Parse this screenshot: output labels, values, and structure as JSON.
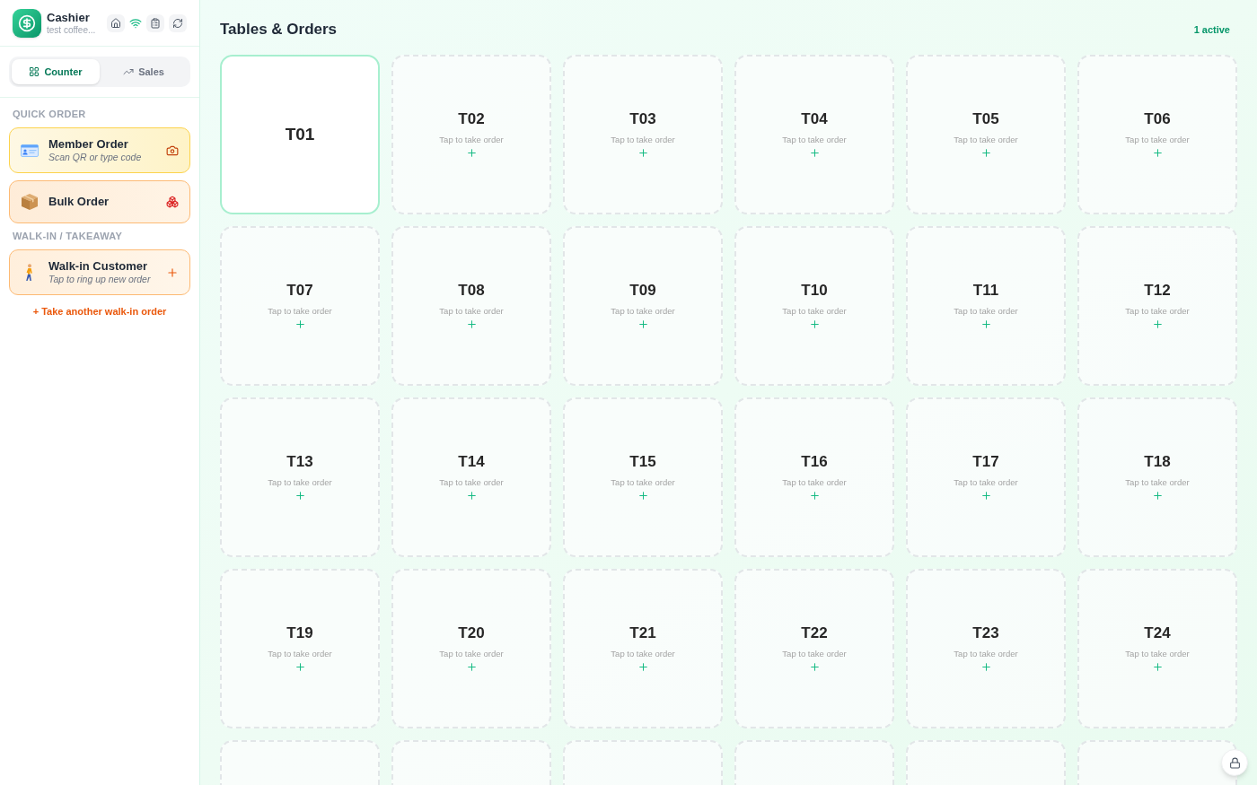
{
  "sidebar": {
    "header": {
      "title": "Cashier",
      "subtitle": "test coffee...",
      "online": true
    },
    "tabs": [
      {
        "label": "Counter",
        "selected": true
      },
      {
        "label": "Sales",
        "selected": false
      }
    ],
    "sections": [
      {
        "heading": "QUICK ORDER",
        "items": [
          {
            "kind": "member",
            "title": "Member Order",
            "subtitle": "Scan QR or type code"
          },
          {
            "kind": "bulk",
            "title": "Bulk Order"
          }
        ]
      },
      {
        "heading": "WALK-IN / TAKEAWAY",
        "items": [
          {
            "kind": "walk_in",
            "title": "Walk-in Customer",
            "subtitle": "Tap to ring up new order"
          }
        ],
        "link": "+ Take another walk-in order"
      }
    ]
  },
  "main": {
    "title": "Tables & Orders",
    "active_count": "1 active",
    "tables": [
      {
        "label": "T01",
        "active": true
      },
      {
        "label": "T02",
        "active": false,
        "hint": "Tap to take order"
      },
      {
        "label": "T03",
        "active": false,
        "hint": "Tap to take order"
      },
      {
        "label": "T04",
        "active": false,
        "hint": "Tap to take order"
      },
      {
        "label": "T05",
        "active": false,
        "hint": "Tap to take order"
      },
      {
        "label": "T06",
        "active": false,
        "hint": "Tap to take order"
      },
      {
        "label": "T07",
        "active": false,
        "hint": "Tap to take order"
      },
      {
        "label": "T08",
        "active": false,
        "hint": "Tap to take order"
      },
      {
        "label": "T09",
        "active": false,
        "hint": "Tap to take order"
      },
      {
        "label": "T10",
        "active": false,
        "hint": "Tap to take order"
      },
      {
        "label": "T11",
        "active": false,
        "hint": "Tap to take order"
      },
      {
        "label": "T12",
        "active": false,
        "hint": "Tap to take order"
      },
      {
        "label": "T13",
        "active": false,
        "hint": "Tap to take order"
      },
      {
        "label": "T14",
        "active": false,
        "hint": "Tap to take order"
      },
      {
        "label": "T15",
        "active": false,
        "hint": "Tap to take order"
      },
      {
        "label": "T16",
        "active": false,
        "hint": "Tap to take order"
      },
      {
        "label": "T17",
        "active": false,
        "hint": "Tap to take order"
      },
      {
        "label": "T18",
        "active": false,
        "hint": "Tap to take order"
      },
      {
        "label": "T19",
        "active": false,
        "hint": "Tap to take order"
      },
      {
        "label": "T20",
        "active": false,
        "hint": "Tap to take order"
      },
      {
        "label": "T21",
        "active": false,
        "hint": "Tap to take order"
      },
      {
        "label": "T22",
        "active": false,
        "hint": "Tap to take order"
      },
      {
        "label": "T23",
        "active": false,
        "hint": "Tap to take order"
      },
      {
        "label": "T24",
        "active": false,
        "hint": "Tap to take order"
      },
      {
        "active": false
      },
      {
        "active": false
      },
      {
        "active": false
      },
      {
        "active": false
      },
      {
        "active": false
      },
      {
        "active": false
      }
    ]
  }
}
